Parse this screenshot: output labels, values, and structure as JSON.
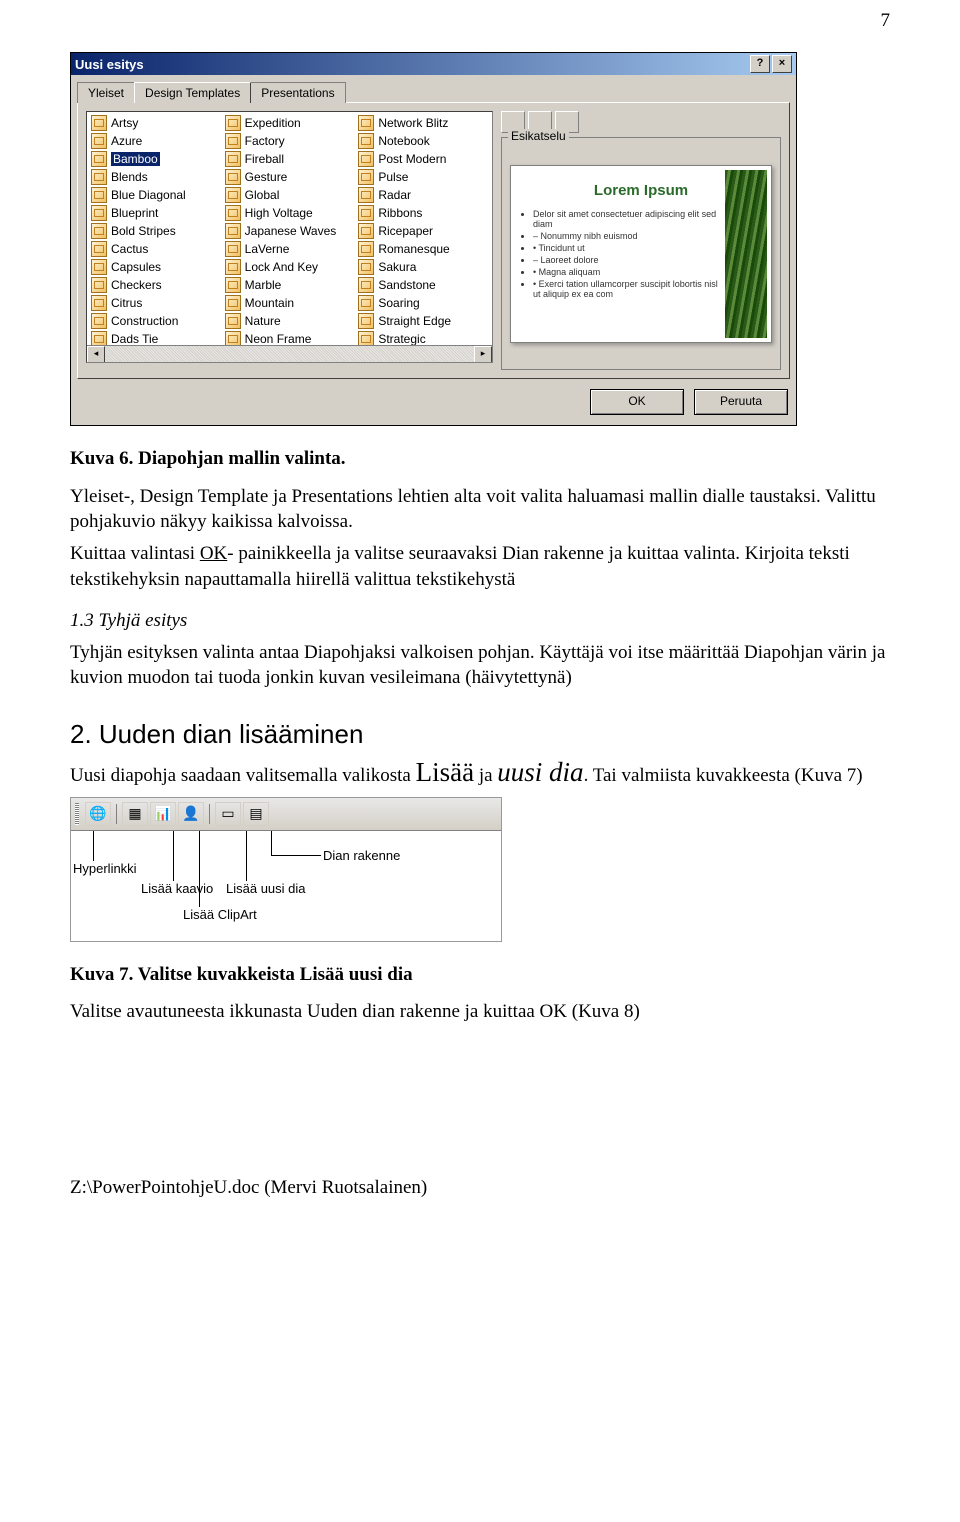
{
  "page_number": "7",
  "dialog": {
    "title": "Uusi esitys",
    "tabs": [
      "Yleiset",
      "Design Templates",
      "Presentations"
    ],
    "active_tab": 1,
    "preview_legend": "Esikatselu",
    "col1": [
      "Artsy",
      "Azure",
      "Bamboo",
      "Blends",
      "Blue Diagonal",
      "Blueprint",
      "Bold Stripes",
      "Cactus",
      "Capsules",
      "Checkers",
      "Citrus",
      "Construction",
      "Dads Tie"
    ],
    "col2": [
      "Expedition",
      "Factory",
      "Fireball",
      "Gesture",
      "Global",
      "High Voltage",
      "Japanese Waves",
      "LaVerne",
      "Lock And Key",
      "Marble",
      "Mountain",
      "Nature",
      "Neon Frame"
    ],
    "col3": [
      "Network Blitz",
      "Notebook",
      "Post Modern",
      "Pulse",
      "Radar",
      "Ribbons",
      "Ricepaper",
      "Romanesque",
      "Sakura",
      "Sandstone",
      "Soaring",
      "Straight Edge",
      "Strategic"
    ],
    "selected": "Bamboo",
    "preview_title": "Lorem Ipsum",
    "preview_bullets": [
      "Delor sit amet consectetuer adipiscing elit sed diam",
      "– Nonummy nibh euismod",
      "  • Tincidunt ut",
      "    – Laoreet dolore",
      "      • Magna aliquam",
      "      • Exerci tation ullamcorper suscipit lobortis nisl ut aliquip ex ea com"
    ],
    "ok": "OK",
    "cancel": "Peruuta"
  },
  "caption6": "Kuva 6. Diapohjan mallin valinta.",
  "para1": "Yleiset-, Design Template ja Presentations lehtien alta voit valita haluamasi mallin dialle taustaksi. Valittu pohjakuvio näkyy kaikissa kalvoissa.",
  "para2a": "Kuittaa valintasi ",
  "para2u": "OK",
  "para2b": "- painikkeella ja valitse seuraavaksi Dian rakenne ja kuittaa valinta. Kirjoita teksti tekstikehyksin napauttamalla hiirellä valittua tekstikehystä",
  "sec13_title": "1.3 Tyhjä esitys",
  "para3": "Tyhjän esityksen valinta antaa Diapohjaksi valkoisen pohjan. Käyttäjä voi itse määrittää Diapohjan värin ja kuvion muodon tai tuoda jonkin kuvan vesileimana (häivytettynä)",
  "sec2_title": "2. Uuden dian lisääminen",
  "para4a": "Uusi diapohja saadaan valitsemalla valikosta ",
  "para4big": "Lisää",
  "para4mid": " ja ",
  "para4i": "uusi dia",
  "para4b": ". Tai valmiista kuvakkeesta (Kuva 7)",
  "tb": {
    "l1": "Hyperlinkki",
    "l2": "Lisää kaavio",
    "l3": "Lisää uusi dia",
    "l4": "Dian rakenne",
    "l5": "Lisää ClipArt"
  },
  "caption7": "Kuva 7. Valitse kuvakkeista Lisää uusi dia",
  "para5": "Valitse  avautuneesta ikkunasta Uuden dian rakenne ja kuittaa OK (Kuva 8)",
  "footer": "Z:\\PowerPointohjeU.doc (Mervi Ruotsalainen)"
}
